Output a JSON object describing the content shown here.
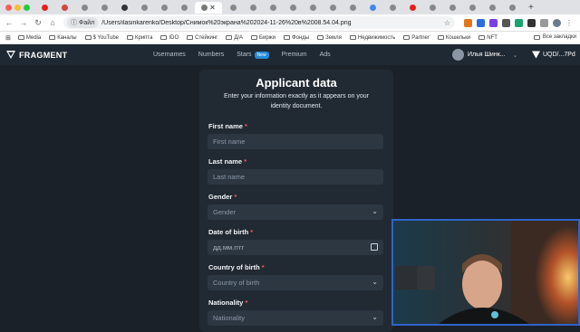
{
  "browser": {
    "omnibox": {
      "scheme_label": "Файл",
      "url": "/Users/ilasinkarenko/Desktop/Снимок%20экрана%202024-11-26%20в%2008.54.04.png"
    },
    "bookmarks": [
      "Media",
      "Каналы",
      "$ YouTube",
      "Крипта",
      "IDO",
      "Стейкинг",
      "Д/А",
      "Биржи",
      "Фонды",
      "Земля",
      "Недвижимость",
      "Partner",
      "Кошельки",
      "NFT"
    ],
    "all_bookmarks_label": "Все закладки"
  },
  "site": {
    "logo_text": "FRAGMENT",
    "nav": {
      "usernames": "Usernames",
      "numbers": "Numbers",
      "stars": "Stars",
      "stars_badge": "New",
      "premium": "Premium",
      "ads": "Ads"
    },
    "user_name": "Илья Шинк...",
    "wallet_label": "UQD/...7Pd"
  },
  "form": {
    "title": "Applicant data",
    "subtitle": "Enter your information exactly as it appears on your identity document.",
    "fields": [
      {
        "label": "First name",
        "placeholder": "First name"
      },
      {
        "label": "Last name",
        "placeholder": "Last name"
      },
      {
        "label": "Gender",
        "placeholder": "Gender"
      },
      {
        "label": "Date of birth",
        "placeholder": "дд.мм.гггг"
      },
      {
        "label": "Country of birth",
        "placeholder": "Country of birth"
      },
      {
        "label": "Nationality",
        "placeholder": "Nationality"
      }
    ],
    "required_mark": "*"
  },
  "colors": {
    "page_bg": "#1a2129",
    "card_bg": "#212a33",
    "input_bg": "#2c3742",
    "required": "#ef5b5b",
    "accent_badge": "#248bda",
    "webcam_border": "#2f64c8"
  }
}
